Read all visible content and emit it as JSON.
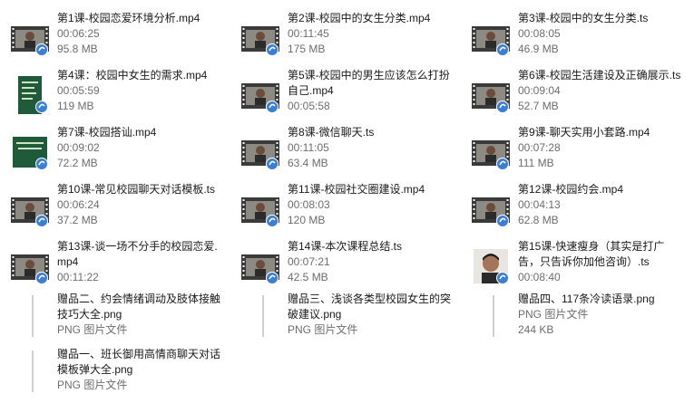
{
  "files": [
    {
      "name": "第1课-校园恋爱环境分析.mp4",
      "meta1": "00:06:25",
      "meta2": "95.8 MB",
      "thumb": "video"
    },
    {
      "name": "第2课-校园中的女生分类.mp4",
      "meta1": "00:11:45",
      "meta2": "175 MB",
      "thumb": "video"
    },
    {
      "name": "第3课-校园中的女生分类.ts",
      "meta1": "00:08:05",
      "meta2": "46.9 MB",
      "thumb": "video"
    },
    {
      "name": "第4课：校园中女生的需求.mp4",
      "meta1": "00:05:59",
      "meta2": "119 MB",
      "thumb": "green-slide"
    },
    {
      "name": "第5课-校园中的男生应该怎么打扮自己.mp4",
      "meta1": "00:05:58",
      "meta2": "",
      "thumb": "video"
    },
    {
      "name": "第6课-校园生活建设及正确展示.ts",
      "meta1": "00:09:04",
      "meta2": "52.7 MB",
      "thumb": "video"
    },
    {
      "name": "第7课-校园搭讪.mp4",
      "meta1": "00:09:02",
      "meta2": "72.2 MB",
      "thumb": "green-slide-wide"
    },
    {
      "name": "第8课-微信聊天.ts",
      "meta1": "00:11:05",
      "meta2": "63.4 MB",
      "thumb": "video"
    },
    {
      "name": "第9课-聊天实用小套路.mp4",
      "meta1": "00:07:28",
      "meta2": "111 MB",
      "thumb": "video"
    },
    {
      "name": "第10课-常见校园聊天对话模板.ts",
      "meta1": "00:06:24",
      "meta2": "37.2 MB",
      "thumb": "video"
    },
    {
      "name": "第11课-校园社交圈建设.mp4",
      "meta1": "00:08:03",
      "meta2": "120 MB",
      "thumb": "video"
    },
    {
      "name": "第12课-校园约会.mp4",
      "meta1": "00:04:13",
      "meta2": "62.8 MB",
      "thumb": "video"
    },
    {
      "name": "第13课-谈一场不分手的校园恋爱.mp4",
      "meta1": "00:11:22",
      "meta2": "",
      "thumb": "video"
    },
    {
      "name": "第14课-本次课程总结.ts",
      "meta1": "00:07:21",
      "meta2": "42.5 MB",
      "thumb": "video"
    },
    {
      "name": "第15课-快速瘦身（其实是打广告，只告诉你加他咨询）.ts",
      "meta1": "00:08:40",
      "meta2": "",
      "thumb": "face"
    },
    {
      "name": "赠品二、约会情绪调动及肢体接触技巧大全.png",
      "meta1": "PNG 图片文件",
      "meta2": "",
      "thumb": "doc"
    },
    {
      "name": "赠品三、浅谈各类型校园女生的突破建议.png",
      "meta1": "PNG 图片文件",
      "meta2": "",
      "thumb": "doc"
    },
    {
      "name": "赠品四、117条冷读语录.png",
      "meta1": "PNG 图片文件",
      "meta2": "244 KB",
      "thumb": "doc"
    },
    {
      "name": "赠品一、班长御用高情商聊天对话模板弹大全.png",
      "meta1": "PNG 图片文件",
      "meta2": "",
      "thumb": "doc"
    }
  ],
  "colors": {
    "filmstrip": "#3a3a3a",
    "sprocket": "#ffffff",
    "badge": "#3a7fd5",
    "green_slide": "#1f5a3a",
    "doc_line": "#d0d0d0"
  }
}
